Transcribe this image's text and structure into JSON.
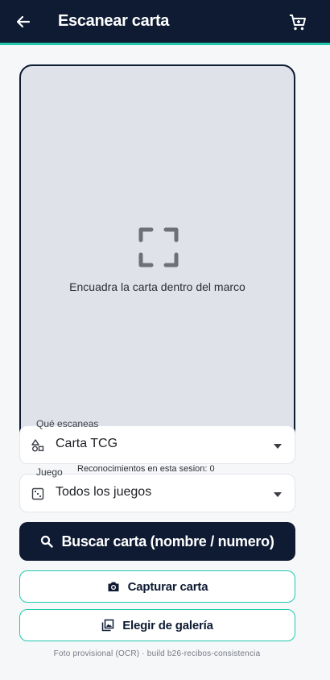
{
  "appbar": {
    "title": "Escanear carta",
    "back_icon": "arrow-left-icon",
    "cart_icon": "cart-icon",
    "color": "#0e1b33",
    "accent": "#20c9ad"
  },
  "viewfinder": {
    "hint": "Encuadra la carta dentro del marco",
    "icon": "crop-frame-icon"
  },
  "scan_type": {
    "label": "Qué escaneas",
    "value": "Carta TCG",
    "icon": "shapes-icon"
  },
  "session_info": "Reconocimientos en esta sesion: 0",
  "game": {
    "label": "Juego",
    "value": "Todos los juegos",
    "icon": "dice-icon"
  },
  "buttons": {
    "search": "Buscar carta (nombre / numero)",
    "capture": "Capturar carta",
    "gallery": "Elegir de galería"
  },
  "footer": "Foto provisional (OCR) · build b26-recibos-consistencia"
}
